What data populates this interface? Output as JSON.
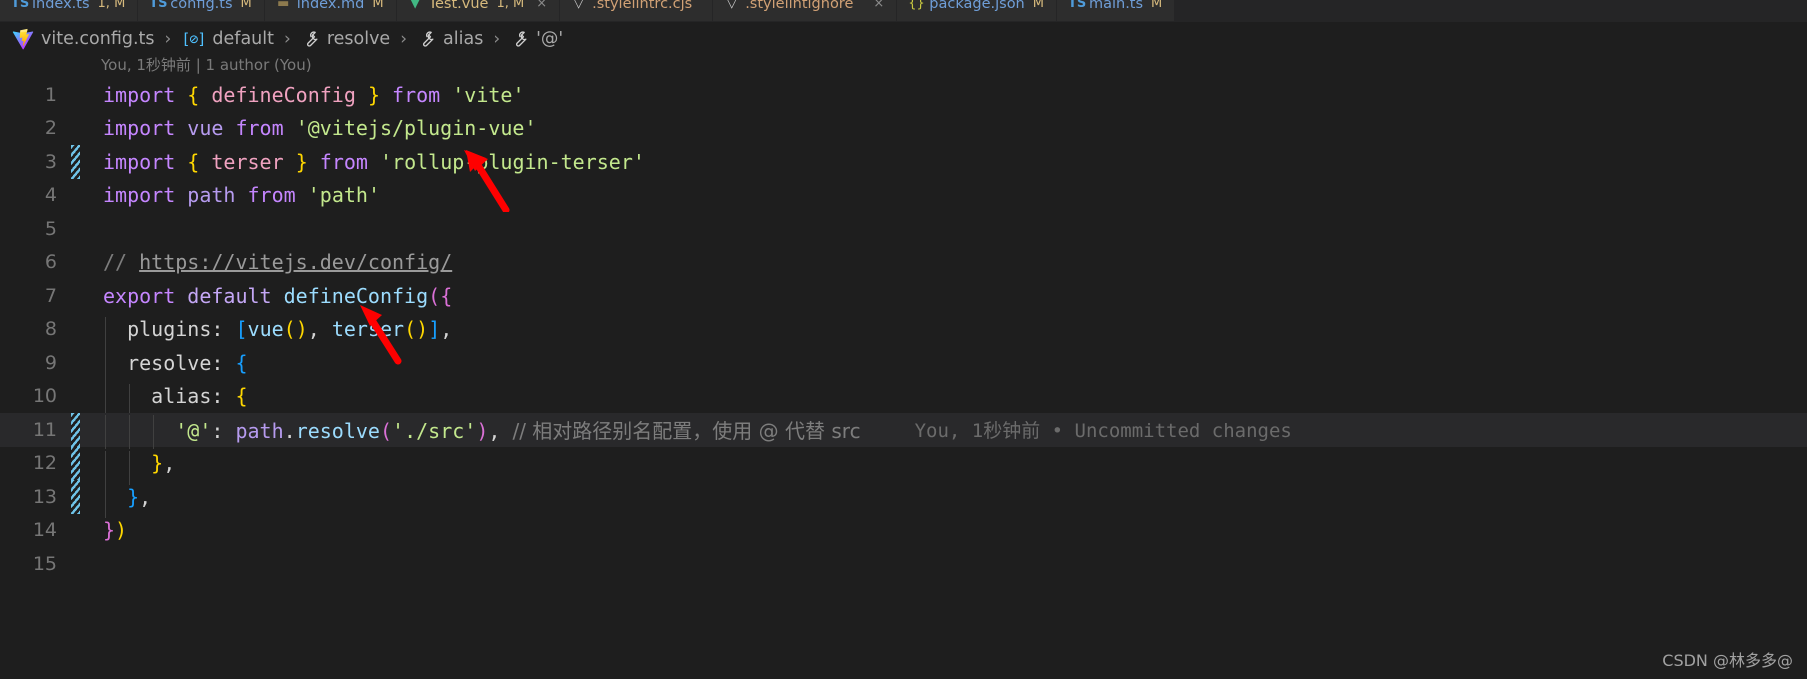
{
  "window": {
    "theme_background": "#1e1e1e",
    "accent": "#4fc1ff"
  },
  "tabs": [
    {
      "label": "index.ts",
      "icon": "typescript-icon",
      "icon_kind": "ic-ts",
      "label_kind": "tl-ts",
      "badge": "1, M",
      "close": "",
      "active": false
    },
    {
      "label": "config.ts",
      "icon": "typescript-icon",
      "icon_kind": "ic-ts",
      "label_kind": "tl-ts",
      "badge": "M",
      "close": "",
      "active": false
    },
    {
      "label": "index.md",
      "icon": "markdown-icon",
      "icon_kind": "ic-md",
      "label_kind": "tl-md",
      "badge": "M",
      "close": "",
      "active": false
    },
    {
      "label": "Test.vue",
      "icon": "vue-icon",
      "icon_kind": "ic-vue",
      "label_kind": "tl-vue",
      "badge": "1, M",
      "close": "×",
      "active": false
    },
    {
      "label": ".stylelintrc.cjs",
      "icon": "vue-icon",
      "icon_kind": "ic-style",
      "label_kind": "tl-plain",
      "badge": "",
      "close": "",
      "active": false
    },
    {
      "label": ".stylelintignore",
      "icon": "vue-icon",
      "icon_kind": "ic-style",
      "label_kind": "tl-plain",
      "badge": "",
      "close": "×",
      "active": false
    },
    {
      "label": "package.json",
      "icon": "json-icon",
      "icon_kind": "ic-json",
      "label_kind": "tl-json",
      "badge": "M",
      "close": "",
      "active": false
    },
    {
      "label": "main.ts",
      "icon": "typescript-icon",
      "icon_kind": "ic-ts",
      "label_kind": "tl-ts",
      "badge": "M",
      "close": "",
      "active": false
    }
  ],
  "breadcrumb": {
    "file": "vite.config.ts",
    "separator": "›",
    "items": [
      {
        "label": "default",
        "icon": "module-cube-icon"
      },
      {
        "label": "resolve",
        "icon": "wrench-icon"
      },
      {
        "label": "alias",
        "icon": "wrench-icon"
      },
      {
        "label": "'@'",
        "icon": "wrench-icon"
      }
    ]
  },
  "blame_header": "You, 1秒钟前 | 1 author (You)",
  "inline_blame": "You, 1秒钟前 • Uncommitted changes",
  "code": {
    "line_numbers": [
      "1",
      "2",
      "3",
      "4",
      "5",
      "6",
      "7",
      "8",
      "9",
      "10",
      "11",
      "12",
      "13",
      "14",
      "15"
    ],
    "lines": [
      "import { defineConfig } from 'vite'",
      "import vue from '@vitejs/plugin-vue'",
      "import { terser } from 'rollup-plugin-terser'",
      "import path from 'path'",
      "",
      "// https://vitejs.dev/config/",
      "export default defineConfig({",
      "  plugins: [vue(), terser()],",
      "  resolve: {",
      "    alias: {",
      "      '@': path.resolve('./src'), // 相对路径别名配置，使用 @ 代替 src",
      "    },",
      "  },",
      "})",
      ""
    ],
    "tokens": {
      "kw_import": "import",
      "kw_from": "from",
      "kw_export": "export",
      "kw_default": "default",
      "name_defineConfig": "defineConfig",
      "name_vue": "vue",
      "name_terser": "terser",
      "name_path": "path",
      "name_resolve": "resolve",
      "str_vite": "'vite'",
      "str_plugin_vue": "'@vitejs/plugin-vue'",
      "str_rollup": "'rollup-plugin-terser'",
      "str_path": "'path'",
      "str_src": "'./src'",
      "str_at": "'@'",
      "comment_slashes": "//",
      "comment_url": "https://vitejs.dev/config/",
      "comment_cn": "// 相对路径别名配置，使用 @ 代替 src",
      "prop_plugins": "plugins",
      "prop_resolve": "resolve",
      "prop_alias": "alias"
    }
  },
  "annotations": {
    "arrow_color": "#ff0000",
    "arrows": [
      {
        "name": "arrow-to-terser-import",
        "points_at": "'rollup-plugin-terser'"
      },
      {
        "name": "arrow-to-terser-plugin",
        "points_at": "terser()"
      }
    ]
  },
  "watermark": "CSDN @林多多@"
}
